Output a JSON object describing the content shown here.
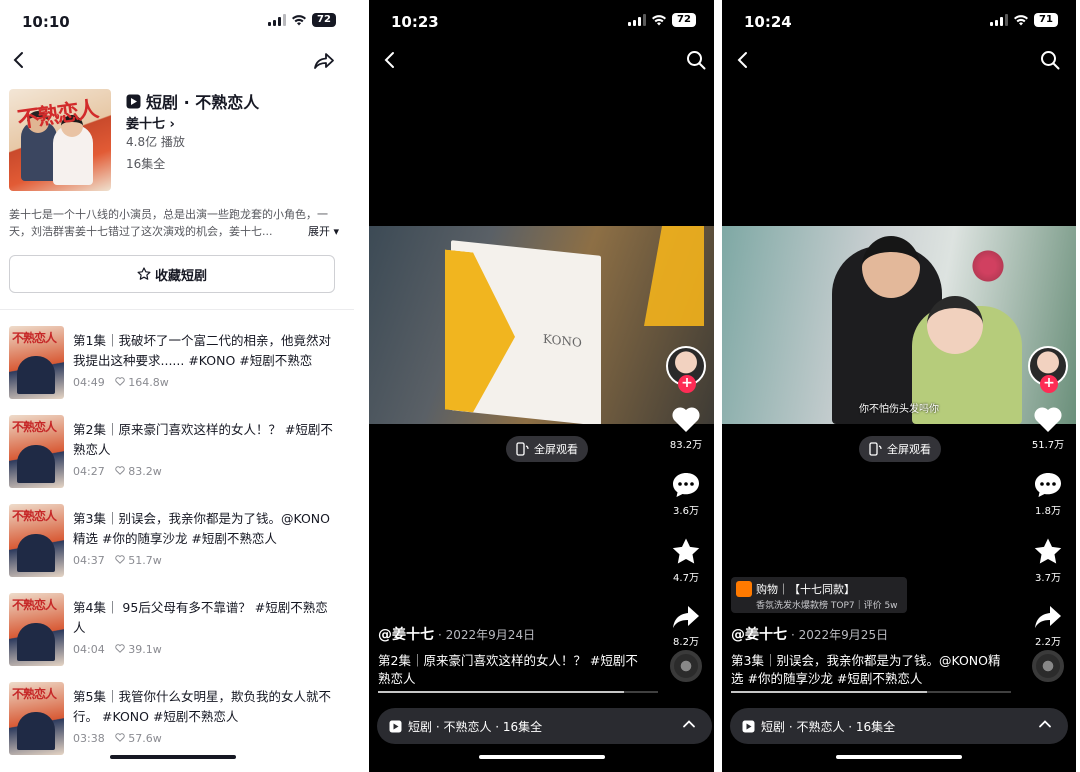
{
  "screen1": {
    "status": {
      "time": "10:10",
      "battery": "72"
    },
    "drama": {
      "title": "短剧 · 不熟恋人",
      "author": "姜十七 ›",
      "plays": "4.8亿 播放",
      "episodes": "16集全",
      "cover_art_text": "不熟恋人"
    },
    "description": "姜十七是一个十八线的小演员，总是出演一些跑龙套的小角色，一天，刘浩群害姜十七错过了这次演戏的机会，姜十七...",
    "expand_label": "展开 ▾",
    "favorite_label": "收藏短剧",
    "episodes": [
      {
        "title": "第1集｜我破坏了一个富二代的相亲，他竟然对我提出这种要求...... #KONO #短剧不熟恋",
        "duration": "04:49",
        "likes": "164.8w"
      },
      {
        "title": "第2集｜原来豪门喜欢这样的女人！？ #短剧不熟恋人",
        "duration": "04:27",
        "likes": "83.2w"
      },
      {
        "title": "第3集｜别误会，我亲你都是为了钱。@KONO精选 #你的随享沙龙 #短剧不熟恋人",
        "duration": "04:37",
        "likes": "51.7w"
      },
      {
        "title": "第4集｜ 95后父母有多不靠谱？ #短剧不熟恋人",
        "duration": "04:04",
        "likes": "39.1w"
      },
      {
        "title": "第5集｜我管你什么女明星，欺负我的女人就不行。 #KONO #短剧不熟恋人",
        "duration": "03:38",
        "likes": "57.6w"
      }
    ],
    "thumb_art_text": "不熟恋人"
  },
  "screen2": {
    "status": {
      "time": "10:23",
      "battery": "72"
    },
    "fullscreen_label": "全屏观看",
    "bag_logo": "KONO",
    "rail": {
      "likes": "83.2万",
      "comments": "3.6万",
      "favorites": "4.7万",
      "shares": "8.2万"
    },
    "author": "@姜十七",
    "date": "· 2022年9月24日",
    "caption": "第2集｜原来豪门喜欢这样的女人！？ #短剧不熟恋人",
    "progress": 0.88,
    "bottom_label": "短剧 · 不熟恋人 · 16集全"
  },
  "screen3": {
    "status": {
      "time": "10:24",
      "battery": "71"
    },
    "fullscreen_label": "全屏观看",
    "subtitle": "你不怕伤头发吗你",
    "rail": {
      "likes": "51.7万",
      "comments": "1.8万",
      "favorites": "3.7万",
      "shares": "2.2万"
    },
    "shop": {
      "line1": "购物｜【十七同款】",
      "line2": "香氛洗发水爆款榜 TOP7｜评价 5w"
    },
    "author": "@姜十七",
    "date": "· 2022年9月25日",
    "caption": "第3集｜别误会，我亲你都是为了钱。@KONO精选 #你的随享沙龙 #短剧不熟恋人",
    "progress": 0.7,
    "bottom_label": "短剧 · 不熟恋人 · 16集全"
  },
  "colors": {
    "accent_red": "#fe2c55",
    "dark_text": "#161823",
    "bar_bg": "#2a2b30"
  }
}
